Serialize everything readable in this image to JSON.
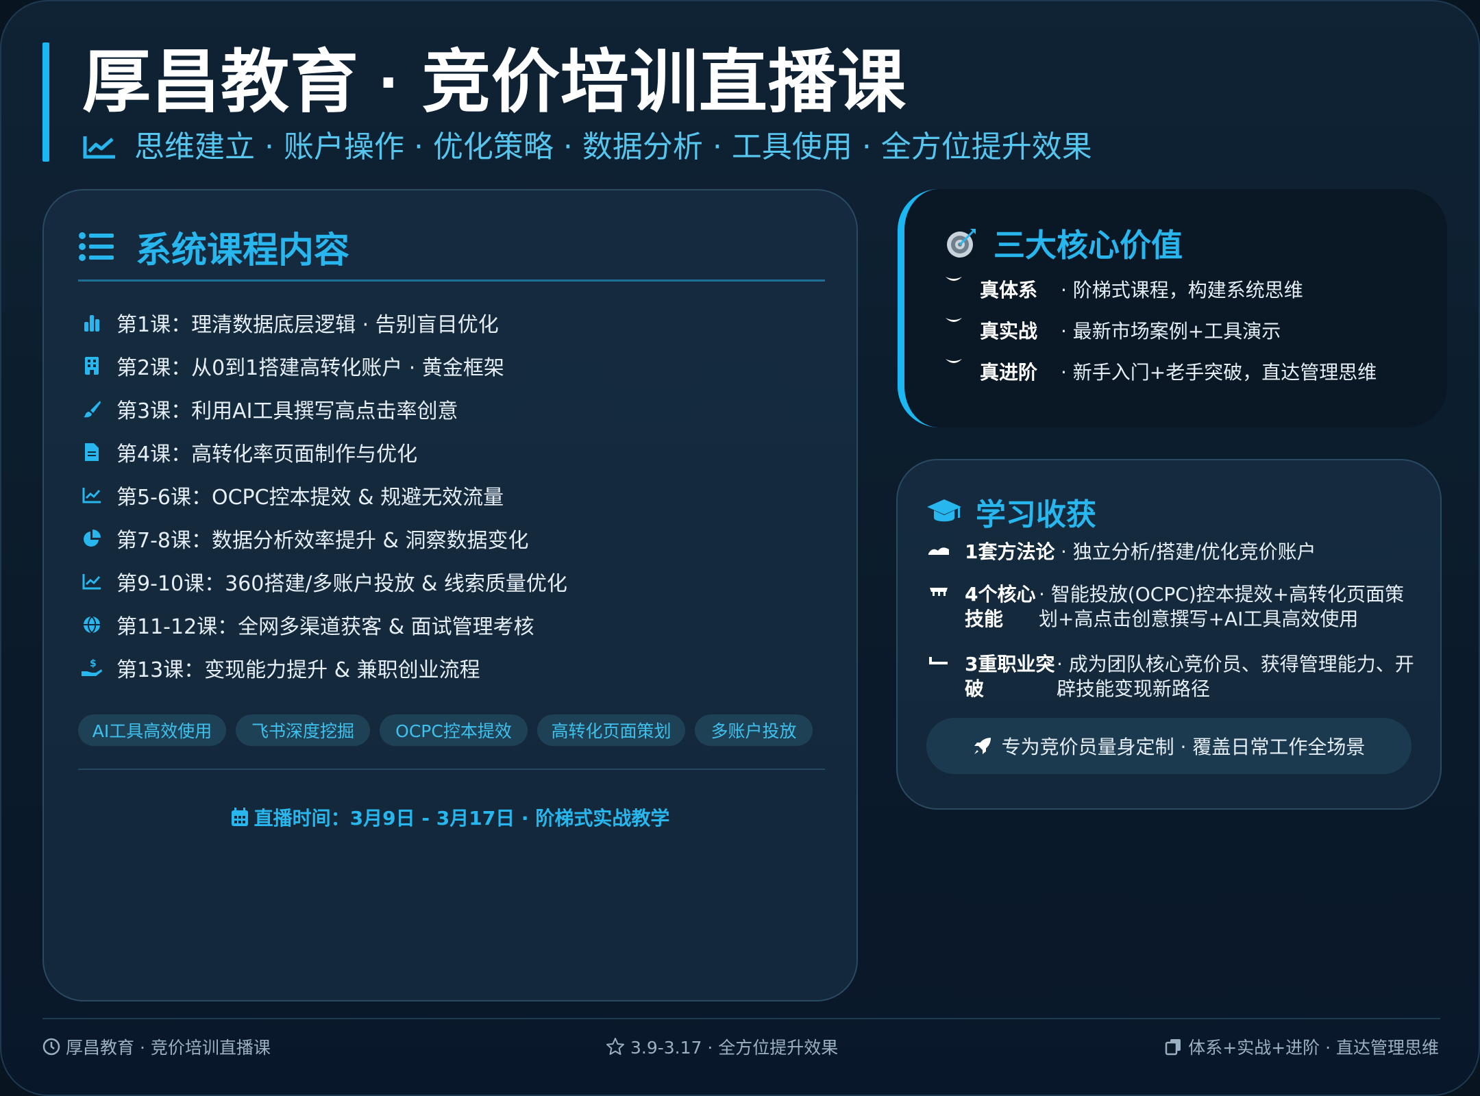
{
  "header": {
    "title": "厚昌教育 · 竞价培训直播课",
    "subtitle": "思维建立 · 账户操作 · 优化策略 · 数据分析 · 工具使用 · 全方位提升效果",
    "subtitle_icon": "line-chart-icon"
  },
  "courses": {
    "heading": "系统课程内容",
    "heading_icon": "list-icon",
    "lessons": [
      {
        "icon": "bar-chart-icon",
        "text": "第1课：理清数据底层逻辑 · 告别盲目优化"
      },
      {
        "icon": "building-icon",
        "text": "第2课：从0到1搭建高转化账户 · 黄金框架"
      },
      {
        "icon": "paintbrush-icon",
        "text": "第3课：利用AI工具撰写高点击率创意"
      },
      {
        "icon": "document-icon",
        "text": "第4课：高转化率页面制作与优化"
      },
      {
        "icon": "line-chart-icon",
        "text": "第5-6课：OCPC控本提效 & 规避无效流量"
      },
      {
        "icon": "pie-chart-icon",
        "text": "第7-8课：数据分析效率提升 & 洞察数据变化"
      },
      {
        "icon": "line-chart-icon",
        "text": "第9-10课：360搭建/多账户投放 & 线索质量优化"
      },
      {
        "icon": "globe-icon",
        "text": "第11-12课：全网多渠道获客 & 面试管理考核"
      },
      {
        "icon": "hand-money-icon",
        "text": "第13课：变现能力提升 & 兼职创业流程"
      }
    ],
    "tags": [
      "AI工具高效使用",
      "飞书深度挖掘",
      "OCPC控本提效",
      "高转化页面策划",
      "多账户投放"
    ],
    "live_time": "直播时间：3月9日 - 3月17日 · 阶梯式实战教学",
    "live_icon": "calendar-icon"
  },
  "core_values": {
    "heading": "三大核心价值",
    "heading_icon": "target-icon",
    "items": [
      {
        "key": "真体系",
        "desc": "· 阶梯式课程，构建系统思维"
      },
      {
        "key": "真实战",
        "desc": "· 最新市场案例+工具演示"
      },
      {
        "key": "真进阶",
        "desc": "· 新手入门+老手突破，直达管理思维"
      }
    ]
  },
  "gains": {
    "heading": "学习收获",
    "heading_icon": "graduation-cap-icon",
    "items": [
      {
        "key": "1套方法论",
        "desc": "· 独立分析/搭建/优化竞价账户"
      },
      {
        "key": "4个核心技能",
        "desc": "· 智能投放(OCPC)控本提效+高转化页面策划+高点击创意撰写+AI工具高效使用"
      },
      {
        "key": "3重职业突破",
        "desc": "· 成为团队核心竞价员、获得管理能力、开辟技能变现新路径"
      }
    ],
    "highlight": "专为竞价员量身定制 · 覆盖日常工作全场景",
    "highlight_icon": "rocket-icon"
  },
  "footer": {
    "left": "厚昌教育 · 竞价培训直播课",
    "left_icon": "clock-icon",
    "middle": "3.9-3.17 · 全方位提升效果",
    "middle_icon": "star-icon",
    "right": "体系+实战+进阶 · 直达管理思维",
    "right_icon": "copy-icon"
  },
  "colors": {
    "background": "#0b1b2a",
    "accent": "#1ab7f2",
    "heading": "#27b6ee",
    "text": "#e6eef6",
    "muted": "#9bb0c2"
  }
}
